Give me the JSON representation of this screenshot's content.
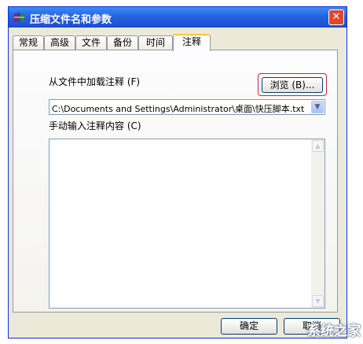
{
  "window": {
    "title": "压缩文件名和参数",
    "close_glyph": "✕",
    "app_icon": "winrar-stack-icon"
  },
  "tabs": [
    {
      "label": "常规",
      "active": false
    },
    {
      "label": "高级",
      "active": false
    },
    {
      "label": "文件",
      "active": false
    },
    {
      "label": "备份",
      "active": false
    },
    {
      "label": "时间",
      "active": false
    },
    {
      "label": "注释",
      "active": true
    }
  ],
  "comment": {
    "load_label": "从文件中加载注释 (F)",
    "browse_label": "浏览 (B)...",
    "file_path": "C:\\Documents and Settings\\Administrator\\桌面\\快压脚本.txt",
    "manual_label": "手动输入注释内容 (C)",
    "manual_text": ""
  },
  "buttons": {
    "ok_label": "确定",
    "cancel_label": "取消"
  },
  "watermark": "系统之家",
  "colors": {
    "title_blue": "#2563e0",
    "highlight_red": "#c0283a",
    "dialog_bg": "#ece9d8"
  }
}
